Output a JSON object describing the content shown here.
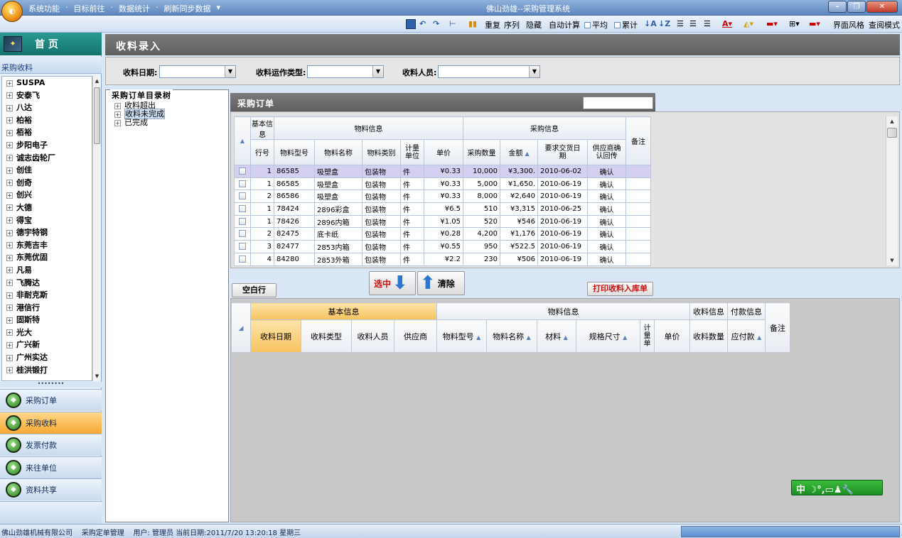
{
  "window": {
    "title": "佛山劲雄--采购管理系统",
    "menu": [
      "系统功能",
      "目标前往",
      "数据统计",
      "刷新同步数据"
    ]
  },
  "toolbar": {
    "items": [
      "重复",
      "序列",
      "隐藏",
      "自动计算",
      "平均",
      "累计",
      "界面风格",
      "查阅模式"
    ]
  },
  "sidebar": {
    "home_label": "首 页",
    "section_title": "采购收料",
    "tree_items": [
      "SUSPA",
      "安泰飞",
      "八达",
      "柏裕",
      "栢裕",
      "步阳电子",
      "诚志齿轮厂",
      "创佳",
      "创奇",
      "创兴",
      "大德",
      "得宝",
      "德宇特钢",
      "东莞吉丰",
      "东莞优固",
      "凡易",
      "飞腾达",
      "非耐克斯",
      "港信行",
      "固斯特",
      "光大",
      "广兴新",
      "广州实达",
      "桂洪锻打"
    ],
    "nav_buttons": [
      {
        "label": "采购订单",
        "active": false
      },
      {
        "label": "采购收料",
        "active": true
      },
      {
        "label": "发票付款",
        "active": false
      },
      {
        "label": "来往单位",
        "active": false
      },
      {
        "label": "资料共享",
        "active": false
      }
    ]
  },
  "main": {
    "title": "收料录入",
    "filters": {
      "date_label": "收料日期:",
      "type_label": "收料运作类型:",
      "person_label": "收料人员:"
    },
    "tree": {
      "title": "采购订单目录树",
      "nodes": [
        "收料超出",
        "收料未完成",
        "已完成"
      ],
      "selected": "收料未完成"
    },
    "orders": {
      "title": "采购订单",
      "group_basic": "基本信息",
      "group_material": "物料信息",
      "group_purchase": "采购信息",
      "col_remark": "备注",
      "columns": [
        "行号",
        "物料型号",
        "物料名称",
        "物料类别",
        "计量单位",
        "单价",
        "采购数量",
        "金额",
        "要求交货日期",
        "供应商确认回传"
      ],
      "rows": [
        {
          "line": "1",
          "model": "86585",
          "name": "吸塑盒",
          "category": "包装物",
          "unit": "件",
          "price": "¥0.33",
          "qty": "10,000",
          "amount": "¥3,300.",
          "date": "2010-06-02",
          "confirm": "确认",
          "selected": true
        },
        {
          "line": "1",
          "model": "86585",
          "name": "吸塑盒",
          "category": "包装物",
          "unit": "件",
          "price": "¥0.33",
          "qty": "5,000",
          "amount": "¥1,650.",
          "date": "2010-06-19",
          "confirm": "确认",
          "selected": false
        },
        {
          "line": "2",
          "model": "86586",
          "name": "吸塑盒",
          "category": "包装物",
          "unit": "件",
          "price": "¥0.33",
          "qty": "8,000",
          "amount": "¥2,640",
          "date": "2010-06-19",
          "confirm": "确认",
          "selected": false
        },
        {
          "line": "1",
          "model": "78424",
          "name": "2896彩盒",
          "category": "包装物",
          "unit": "件",
          "price": "¥6.5",
          "qty": "510",
          "amount": "¥3,315",
          "date": "2010-06-25",
          "confirm": "确认",
          "selected": false
        },
        {
          "line": "1",
          "model": "78426",
          "name": "2896内箱",
          "category": "包装物",
          "unit": "件",
          "price": "¥1.05",
          "qty": "520",
          "amount": "¥546",
          "date": "2010-06-19",
          "confirm": "确认",
          "selected": false
        },
        {
          "line": "2",
          "model": "82475",
          "name": "底卡纸",
          "category": "包装物",
          "unit": "件",
          "price": "¥0.28",
          "qty": "4,200",
          "amount": "¥1,176",
          "date": "2010-06-19",
          "confirm": "确认",
          "selected": false
        },
        {
          "line": "3",
          "model": "82477",
          "name": "2853内箱",
          "category": "包装物",
          "unit": "件",
          "price": "¥0.55",
          "qty": "950",
          "amount": "¥522.5",
          "date": "2010-06-19",
          "confirm": "确认",
          "selected": false
        },
        {
          "line": "4",
          "model": "84280",
          "name": "2853外箱",
          "category": "包装物",
          "unit": "件",
          "price": "¥2.2",
          "qty": "230",
          "amount": "¥506",
          "date": "2010-06-19",
          "confirm": "确认",
          "selected": false
        }
      ]
    },
    "actions": {
      "select_label": "选中",
      "clear_label": "清除",
      "blank_row_label": "空白行",
      "print_label": "打印收料入库单"
    },
    "receipts": {
      "group_basic": "基本信息",
      "group_material": "物料信息",
      "group_receive": "收料信息",
      "group_payment": "付款信息",
      "col_remark": "备注",
      "columns": [
        "收料日期",
        "收料类型",
        "收料人员",
        "供应商",
        "物料型号",
        "物料名称",
        "材料",
        "规格尺寸",
        "计量单",
        "单价",
        "收料数量",
        "应付款"
      ]
    },
    "ime_text": "中"
  },
  "statusbar": {
    "company": "佛山劲雄机械有限公司",
    "module": "采购定单管理",
    "user": "用户: 管理员",
    "datetime": "当前日期:2011/7/20 13:20:18 星期三"
  }
}
